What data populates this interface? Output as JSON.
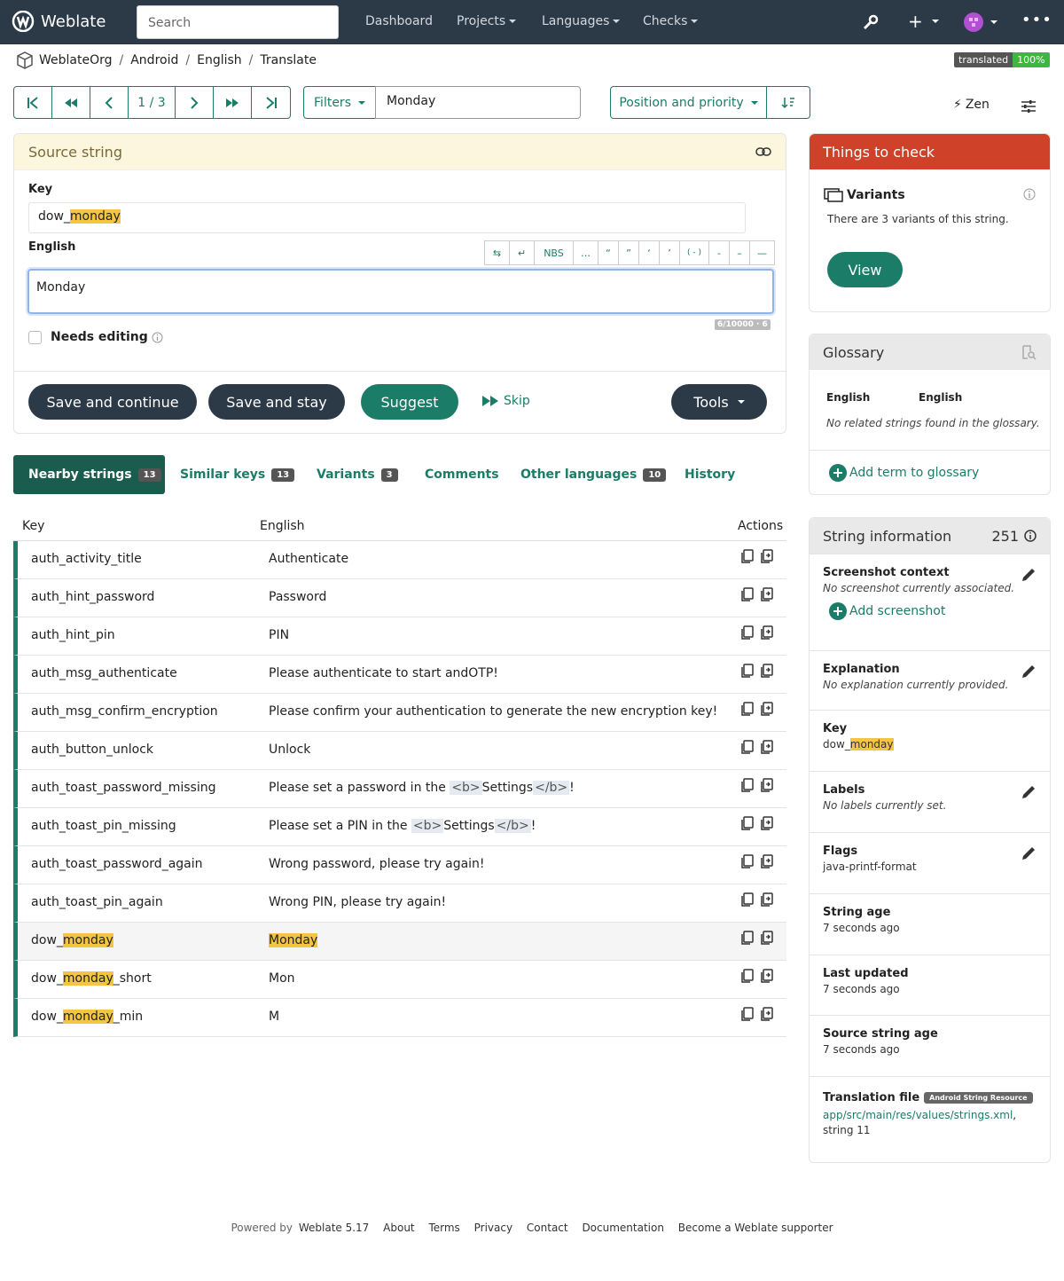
{
  "navbar": {
    "brand": "Weblate",
    "search_placeholder": "Search",
    "links": [
      "Dashboard",
      "Projects",
      "Languages",
      "Checks"
    ]
  },
  "breadcrumb": [
    "WeblateOrg",
    "Android",
    "English",
    "Translate"
  ],
  "status": {
    "label": "translated",
    "value": "100%"
  },
  "pager": {
    "position": "1 / 3"
  },
  "filters": {
    "label": "Filters",
    "query": "Monday"
  },
  "sort": {
    "label": "Position and priority"
  },
  "zen": "Zen",
  "source": {
    "header": "Source string",
    "key_label": "Key",
    "key_prefix": "dow_",
    "key_highlight": "monday",
    "lang_label": "English",
    "special_chars": [
      "⇆",
      "↵",
      "NBS",
      "…",
      "“",
      "”",
      "‘",
      "’",
      "( - )",
      "-",
      "–",
      "—"
    ],
    "value": "Monday",
    "counter": "6/10000 · 6",
    "needs_editing": "Needs editing"
  },
  "actions": {
    "save_continue": "Save and continue",
    "save_stay": "Save and stay",
    "suggest": "Suggest",
    "skip": "Skip",
    "tools": "Tools"
  },
  "tabs": [
    {
      "label": "Nearby strings",
      "count": "13"
    },
    {
      "label": "Similar keys",
      "count": "13"
    },
    {
      "label": "Variants",
      "count": "3"
    },
    {
      "label": "Comments",
      "count": ""
    },
    {
      "label": "Other languages",
      "count": "10"
    },
    {
      "label": "History",
      "count": ""
    }
  ],
  "table": {
    "headers": [
      "Key",
      "English",
      "Actions"
    ],
    "rows": [
      {
        "k": "auth_activity_title",
        "v": "Authenticate"
      },
      {
        "k": "auth_hint_password",
        "v": "Password"
      },
      {
        "k": "auth_hint_pin",
        "v": "PIN"
      },
      {
        "k": "auth_msg_authenticate",
        "v": "Please authenticate to start andOTP!"
      },
      {
        "k": "auth_msg_confirm_encryption",
        "v": "Please confirm your authentication to generate the new encryption key!"
      },
      {
        "k": "auth_button_unlock",
        "v": "Unlock"
      },
      {
        "k": "auth_toast_password_missing",
        "v1": "Please set a password in the ",
        "t1": "<b>",
        "m": "Settings",
        "t2": "</b>",
        "v2": "!"
      },
      {
        "k": "auth_toast_pin_missing",
        "v1": "Please set a PIN in the ",
        "t1": "<b>",
        "m": "Settings",
        "t2": "</b>",
        "v2": "!"
      },
      {
        "k": "auth_toast_password_again",
        "v": "Wrong password, please try again!"
      },
      {
        "k": "auth_toast_pin_again",
        "v": "Wrong PIN, please try again!"
      },
      {
        "k1": "dow_",
        "kh": "monday",
        "k2": "",
        "vh": "Monday"
      },
      {
        "k1": "dow_",
        "kh": "monday",
        "k2": "_short",
        "v": "Mon"
      },
      {
        "k1": "dow_",
        "kh": "monday",
        "k2": "_min",
        "v": "M"
      }
    ]
  },
  "checks": {
    "header": "Things to check",
    "title": "Variants",
    "text": "There are 3 variants of this string.",
    "button": "View"
  },
  "glossary": {
    "header": "Glossary",
    "col1": "English",
    "col2": "English",
    "empty": "No related strings found in the glossary.",
    "add": "Add term to glossary"
  },
  "info": {
    "header": "String information",
    "count": "251",
    "screenshot_t": "Screenshot context",
    "screenshot_i": "No screenshot currently associated.",
    "screenshot_add": "Add screenshot",
    "explanation_t": "Explanation",
    "explanation_i": "No explanation currently provided.",
    "key_t": "Key",
    "key_prefix": "dow_",
    "key_hl": "monday",
    "labels_t": "Labels",
    "labels_i": "No labels currently set.",
    "flags_t": "Flags",
    "flags_v": "java-printf-format",
    "age_t": "String age",
    "age_v": "7 seconds ago",
    "updated_t": "Last updated",
    "updated_v": "7 seconds ago",
    "src_age_t": "Source string age",
    "src_age_v": "7 seconds ago",
    "file_t": "Translation file",
    "file_badge": "Android String Resource",
    "file_path": "app/src/main/res/values/strings.xml",
    "file_comma": ",",
    "file_idx": "string 11"
  },
  "footer": {
    "powered": "Powered by",
    "version": "Weblate 5.17",
    "links": [
      "About",
      "Terms",
      "Privacy",
      "Contact",
      "Documentation",
      "Become a Weblate supporter"
    ]
  },
  "colors": {
    "accent": "#1b7c68",
    "dark": "#2c3a48",
    "danger": "#d0412a",
    "highlight": "#f4c542"
  }
}
